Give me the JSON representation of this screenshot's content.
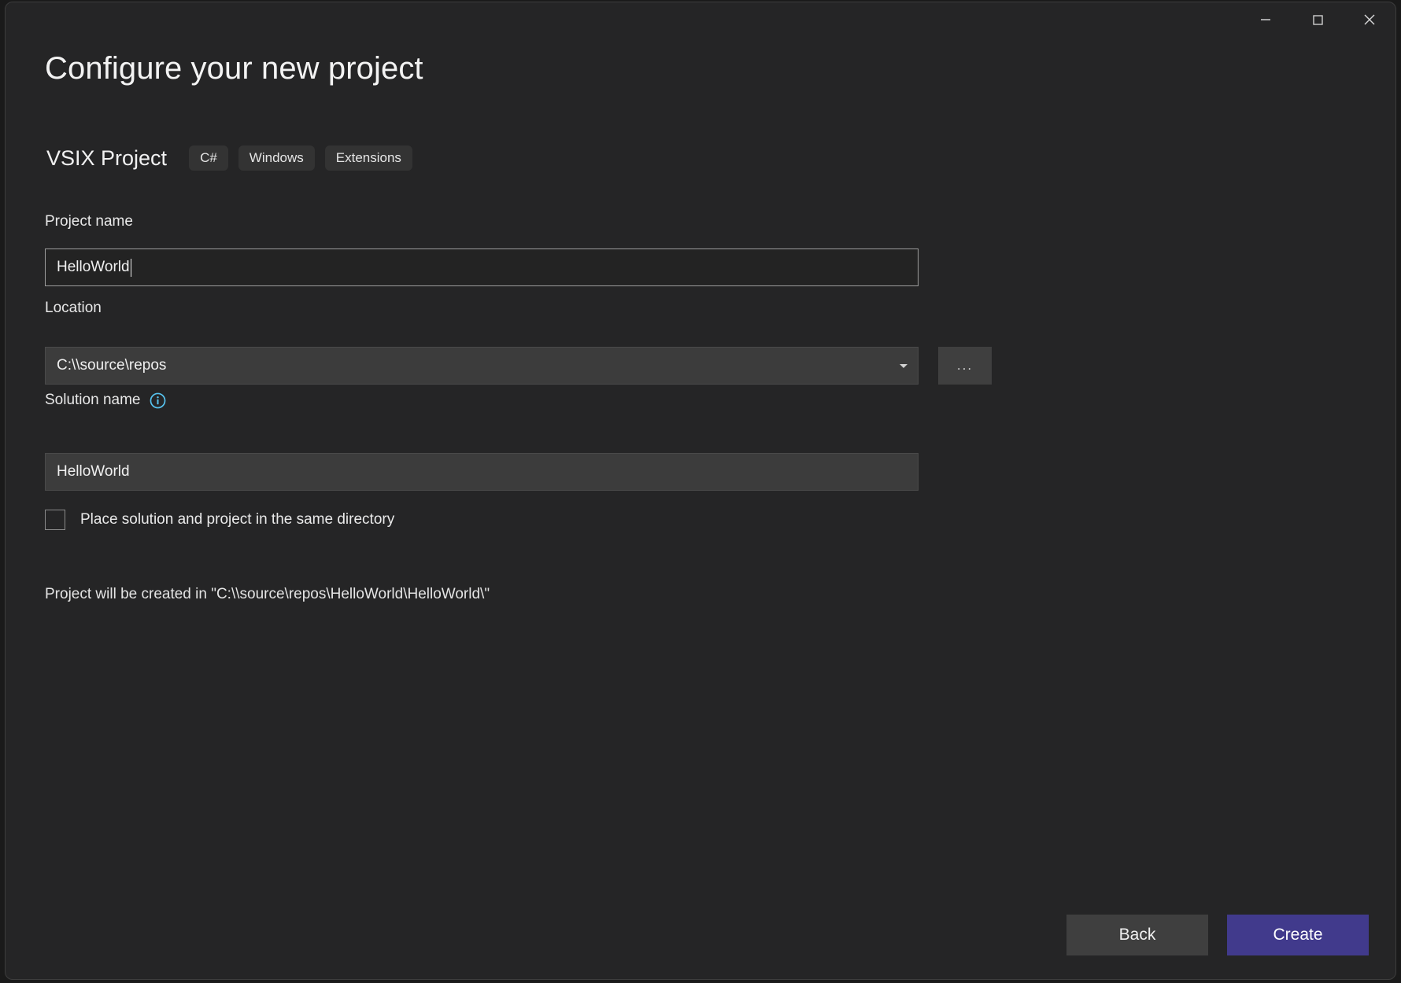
{
  "window": {
    "controls": {
      "minimize": "minimize-icon",
      "maximize": "maximize-icon",
      "close": "close-icon"
    }
  },
  "header": {
    "title": "Configure your new project",
    "template_name": "VSIX Project",
    "tags": [
      "C#",
      "Windows",
      "Extensions"
    ]
  },
  "form": {
    "project_name": {
      "label": "Project name",
      "value": "HelloWorld"
    },
    "location": {
      "label": "Location",
      "value": "C:\\\\source\\repos",
      "dropdown_icon": "chevron-down-icon",
      "browse_label": "..."
    },
    "solution_name": {
      "label": "Solution name",
      "info_icon": "info-icon",
      "value": "HelloWorld"
    },
    "same_directory": {
      "label": "Place solution and project in the same directory",
      "checked": false
    },
    "status": "Project will be created in \"C:\\\\source\\repos\\HelloWorld\\HelloWorld\\\""
  },
  "footer": {
    "back_label": "Back",
    "create_label": "Create"
  },
  "colors": {
    "dialog_background": "#252526",
    "accent_create": "#413a8c",
    "field_background": "#3c3c3c",
    "focused_field_border": "#9d9d9d",
    "info_icon": "#57c4f0",
    "tag_background": "#333333"
  }
}
